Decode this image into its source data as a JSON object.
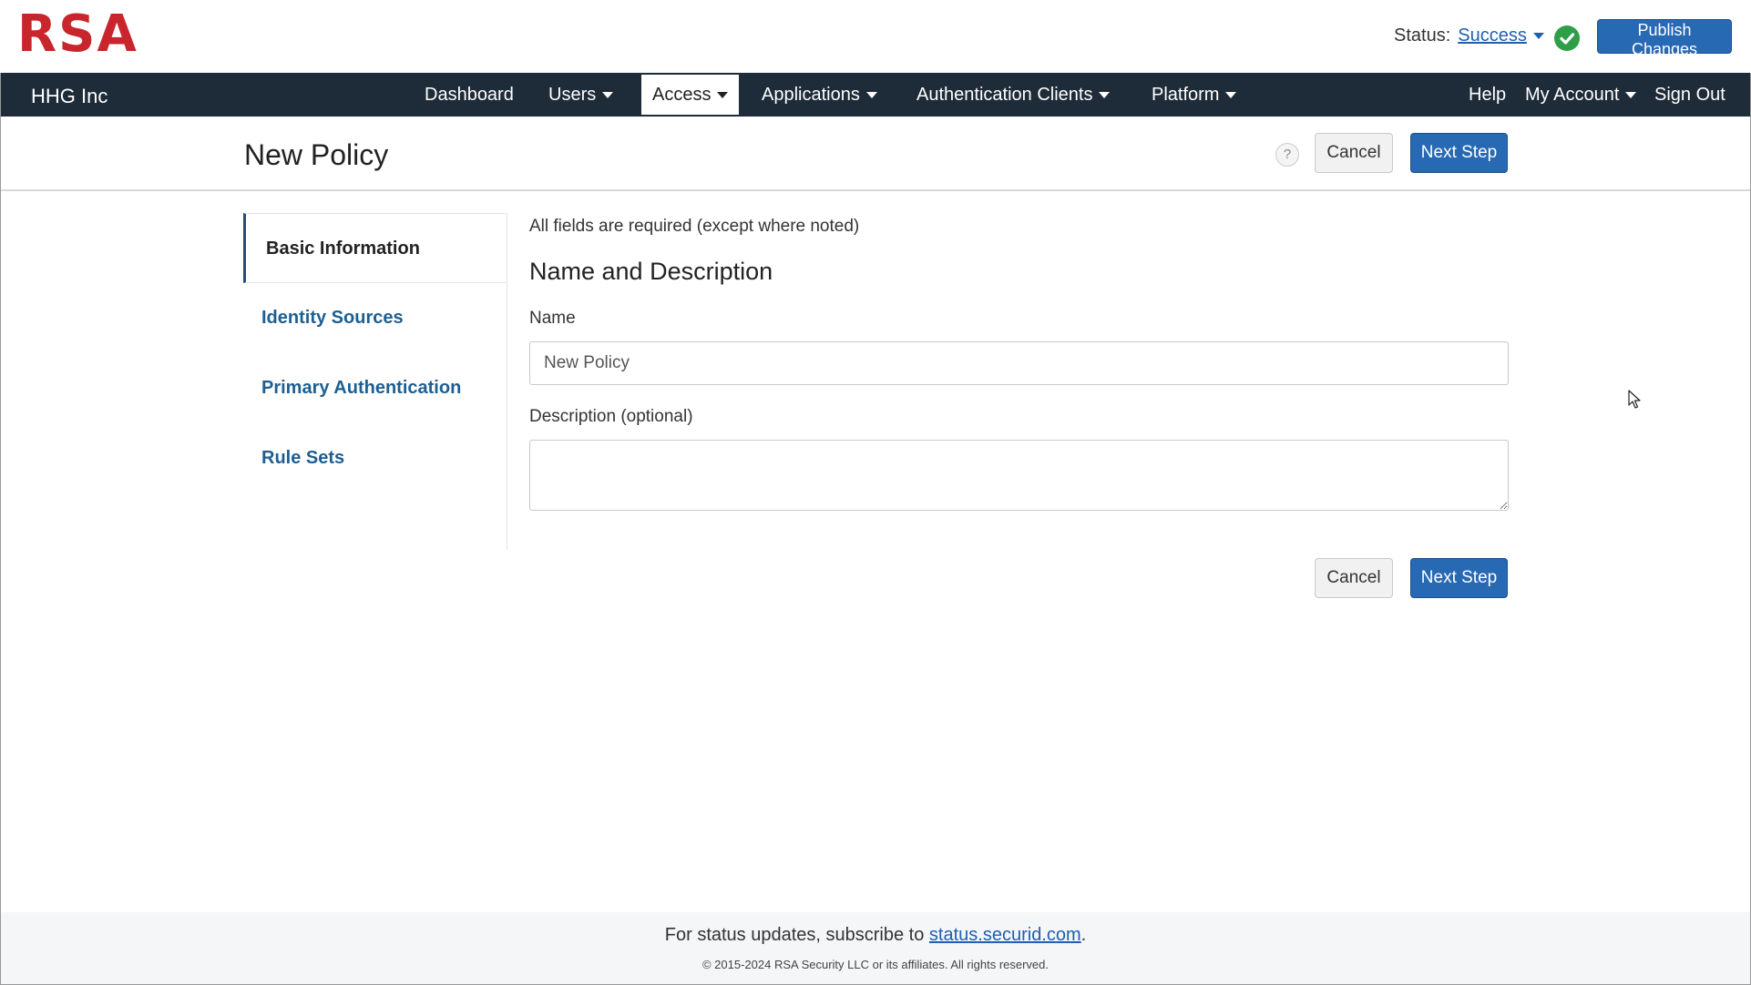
{
  "header": {
    "logo": "RSA",
    "status_label": "Status:",
    "status_value": "Success",
    "publish_label": "Publish Changes"
  },
  "nav": {
    "brand": "HHG Inc",
    "items": [
      {
        "label": "Dashboard"
      },
      {
        "label": "Users"
      },
      {
        "label": "Access"
      },
      {
        "label": "Applications"
      },
      {
        "label": "Authentication Clients"
      },
      {
        "label": "Platform"
      }
    ],
    "right": [
      {
        "label": "Help"
      },
      {
        "label": "My Account"
      },
      {
        "label": "Sign Out"
      }
    ]
  },
  "page": {
    "title": "New Policy",
    "help": "?",
    "cancel_label": "Cancel",
    "next_label": "Next Step"
  },
  "sidenav": {
    "items": [
      {
        "label": "Basic Information"
      },
      {
        "label": "Identity Sources"
      },
      {
        "label": "Primary Authentication"
      },
      {
        "label": "Rule Sets"
      }
    ]
  },
  "form": {
    "required_note": "All fields are required (except where noted)",
    "section_title": "Name and Description",
    "name_label": "Name",
    "name_value": "New Policy",
    "description_label": "Description (optional)",
    "description_value": ""
  },
  "footer": {
    "prefix": "For status updates, subscribe to ",
    "link": "status.securid.com",
    "suffix": ".",
    "copyright": "© 2015-2024 RSA Security LLC or its affiliates. All rights reserved."
  },
  "colors": {
    "brand_red": "#c8262c",
    "navbar": "#1e2b38",
    "primary_button": "#2869b3",
    "success": "#2e9e47",
    "link": "#1d5f92"
  }
}
